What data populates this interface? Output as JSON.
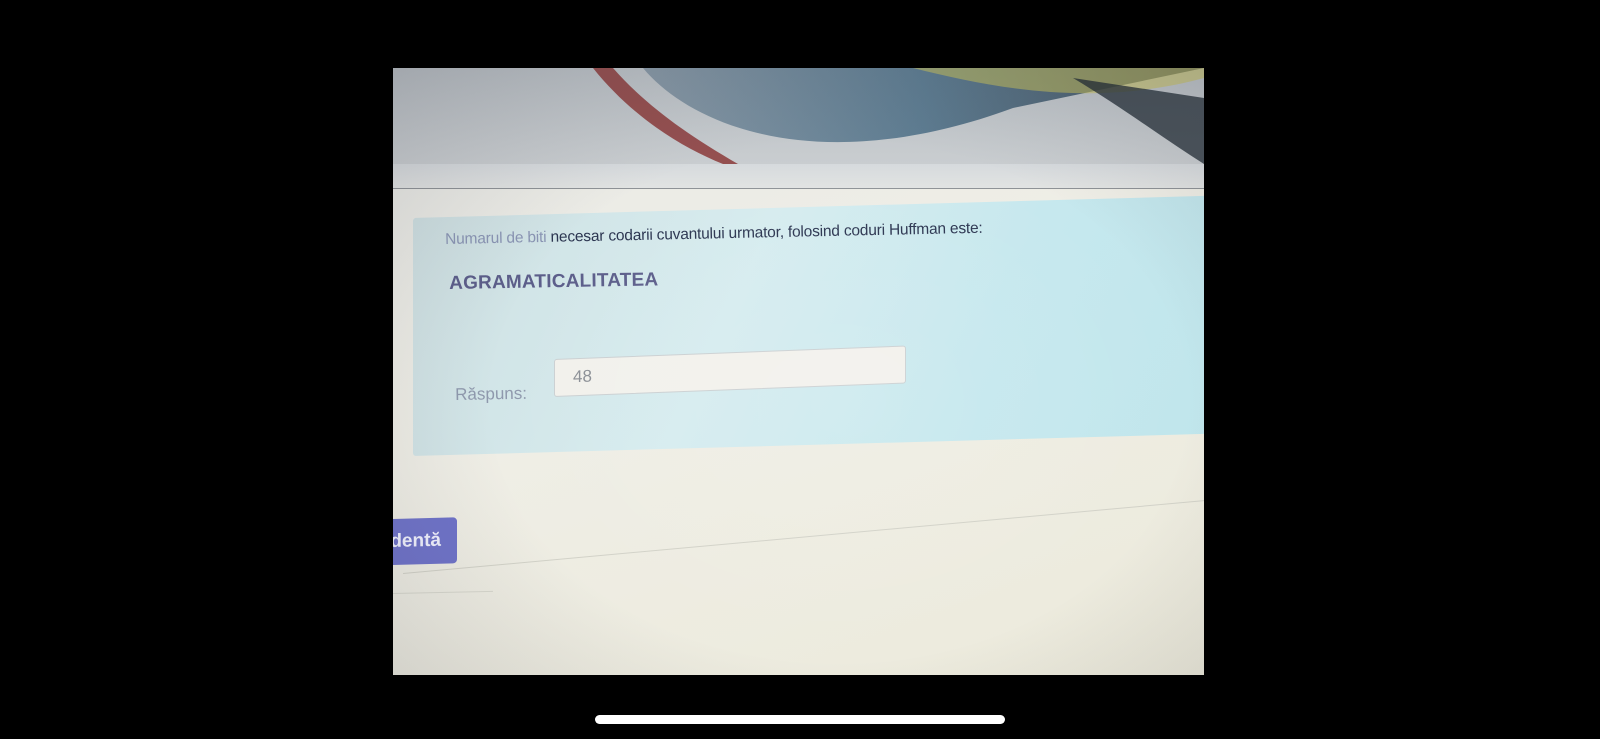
{
  "quiz": {
    "question_faded": "Numarul de biti",
    "question_rest": " necesar codarii cuvantului urmator, folosind coduri Huffman este:",
    "keyword": "AGRAMATICALITATEA",
    "answer_label": "Răspuns:",
    "answer_value": "48"
  },
  "navigation": {
    "prev_label": "dentă"
  },
  "colors": {
    "panel": "#c6e8ee",
    "button": "#6f73c9",
    "keyword": "#5c5e8a",
    "background": "#000000"
  }
}
